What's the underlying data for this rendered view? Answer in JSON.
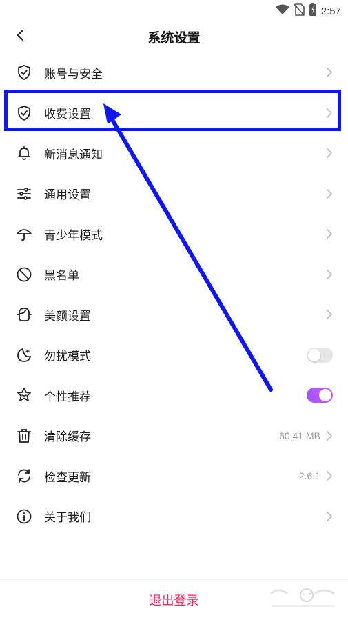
{
  "status": {
    "time": "2:57"
  },
  "header": {
    "title": "系统设置"
  },
  "items": [
    {
      "label": "账号与安全",
      "icon": "shield-check-icon",
      "right": "chevron"
    },
    {
      "label": "收费设置",
      "icon": "shield-check-icon",
      "right": "chevron"
    },
    {
      "label": "新消息通知",
      "icon": "bell-icon",
      "right": "chevron"
    },
    {
      "label": "通用设置",
      "icon": "sliders-icon",
      "right": "chevron"
    },
    {
      "label": "青少年模式",
      "icon": "umbrella-icon",
      "right": "chevron"
    },
    {
      "label": "黑名单",
      "icon": "block-icon",
      "right": "chevron"
    },
    {
      "label": "美颜设置",
      "icon": "face-beauty-icon",
      "right": "chevron"
    },
    {
      "label": "勿扰模式",
      "icon": "moon-star-icon",
      "right": "toggle-off"
    },
    {
      "label": "个性推荐",
      "icon": "star-badge-icon",
      "right": "toggle-on"
    },
    {
      "label": "清除缓存",
      "icon": "trash-icon",
      "right": "chevron",
      "value": "60.41 MB"
    },
    {
      "label": "检查更新",
      "icon": "refresh-icon",
      "right": "chevron",
      "value": "2.6.1"
    },
    {
      "label": "关于我们",
      "icon": "info-icon",
      "right": "chevron"
    }
  ],
  "logout": {
    "label": "退出登录"
  },
  "colors": {
    "accent": "#f2255c",
    "toggle_on": "#b055ff",
    "highlight": "#1016ee"
  }
}
